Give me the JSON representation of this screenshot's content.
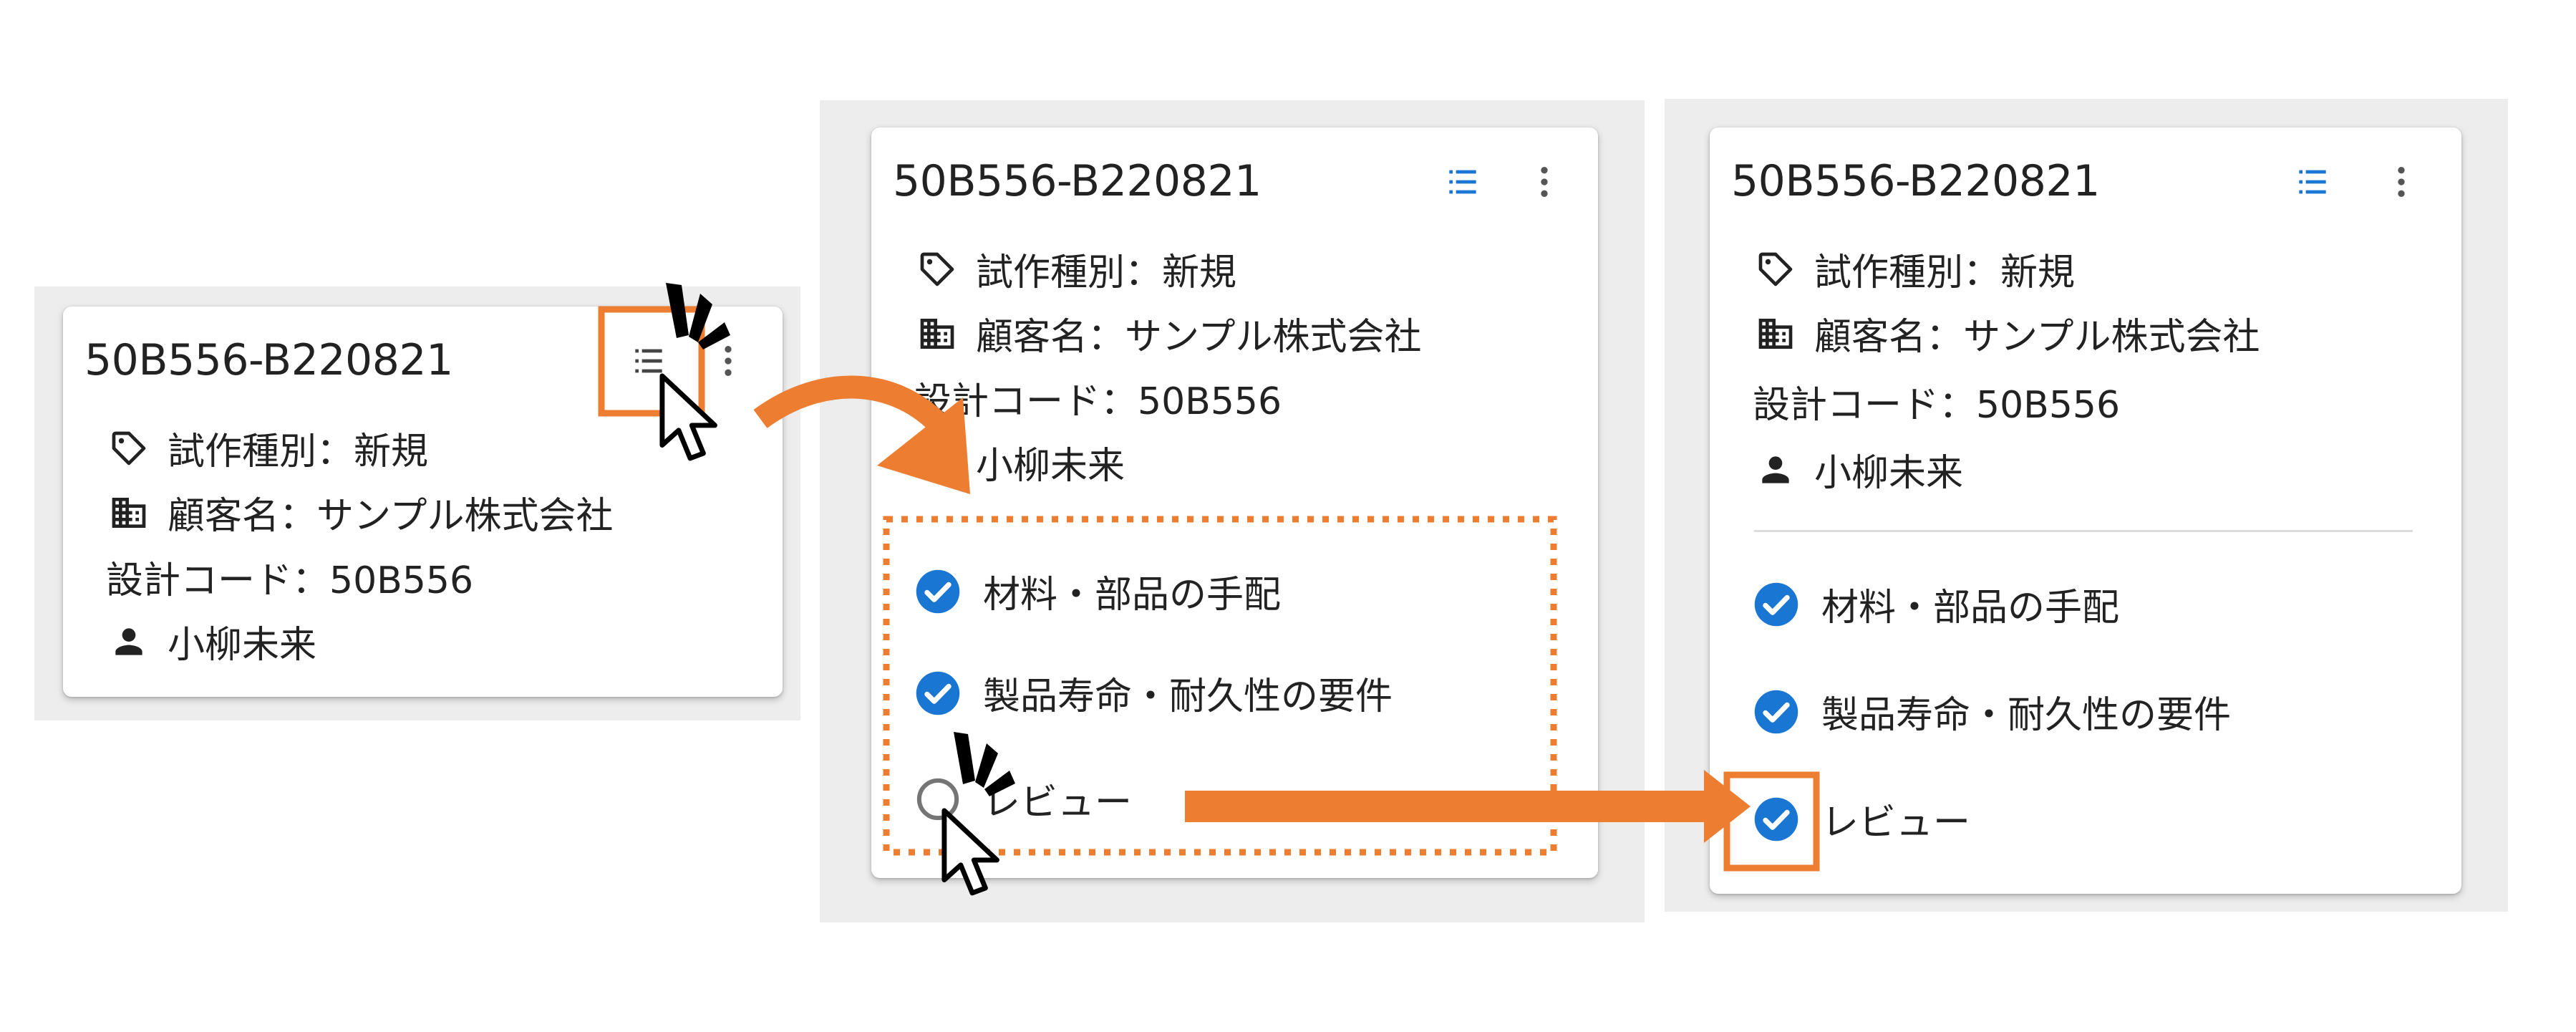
{
  "accent_color": "#1976d2",
  "highlight_color": "#ed7d31",
  "card": {
    "title": "50B556-B220821",
    "prototype_type": "試作種別：新規",
    "customer": "顧客名：サンプル株式会社",
    "design_code": "設計コード：50B556",
    "assignee": "小柳未来"
  },
  "tasks": [
    {
      "label": "材料・部品の手配"
    },
    {
      "label": "製品寿命・耐久性の要件"
    },
    {
      "label": "レビュー"
    }
  ],
  "icons": {
    "checklist": "format-list-bulleted-icon",
    "more": "dots-vertical-icon",
    "tag": "tag-outline-icon",
    "customer": "domain-icon",
    "assignee": "account-icon",
    "checked": "check-circle-icon",
    "unchecked": "circle-outline-icon"
  }
}
